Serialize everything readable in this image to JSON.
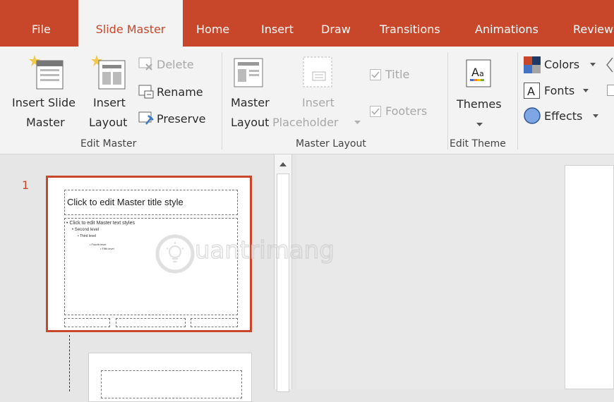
{
  "tabs": [
    {
      "label": "File",
      "active": false
    },
    {
      "label": "Slide Master",
      "active": true
    },
    {
      "label": "Home",
      "active": false
    },
    {
      "label": "Insert",
      "active": false
    },
    {
      "label": "Draw",
      "active": false
    },
    {
      "label": "Transitions",
      "active": false
    },
    {
      "label": "Animations",
      "active": false
    },
    {
      "label": "Review",
      "active": false
    }
  ],
  "edit_master": {
    "insert_slide_master": [
      "Insert Slide",
      "Master"
    ],
    "insert_layout": [
      "Insert",
      "Layout"
    ],
    "delete": "Delete",
    "rename": "Rename",
    "preserve": "Preserve",
    "group_label": "Edit Master"
  },
  "master_layout": {
    "master_layout": [
      "Master",
      "Layout"
    ],
    "insert_placeholder": [
      "Insert",
      "Placeholder"
    ],
    "title": "Title",
    "footers": "Footers",
    "group_label": "Master Layout"
  },
  "edit_theme": {
    "themes": "Themes",
    "group_label": "Edit Theme"
  },
  "background": {
    "colors": "Colors",
    "fonts": "Fonts",
    "effects": "Effects"
  },
  "thumbnails": [
    {
      "number": "1",
      "title": "Click to edit Master title style",
      "body": [
        "Click to edit Master text styles",
        "Second level",
        "Third level",
        "Fourth level",
        "Fifth level"
      ]
    }
  ],
  "watermark": "uantrimang",
  "colors": {
    "accent": "#c8472b",
    "ribbon": "#f3f3f3",
    "selection": "#c8472b"
  }
}
